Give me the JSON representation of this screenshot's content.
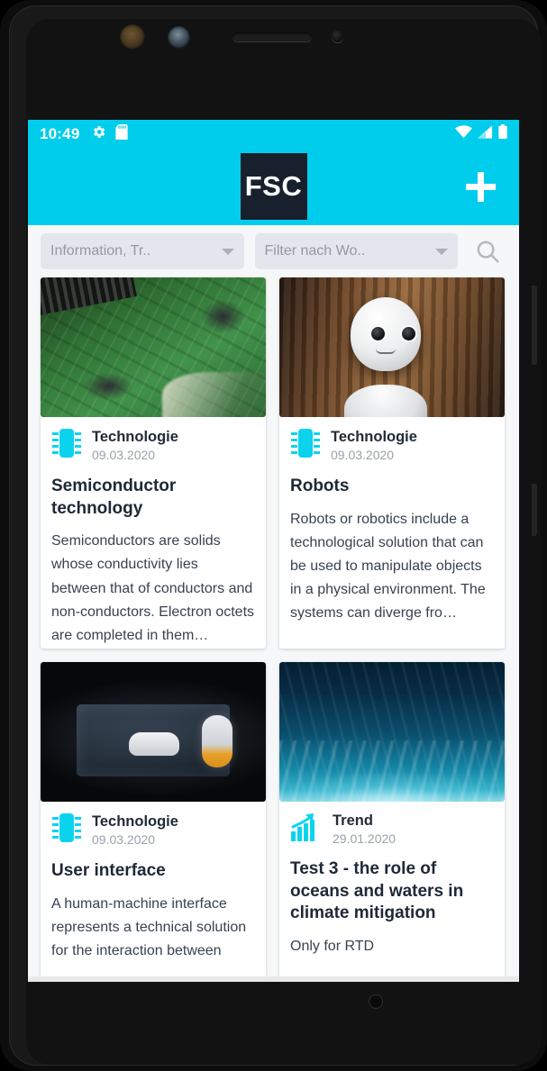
{
  "status_bar": {
    "time": "10:49",
    "left_icons": [
      "gear-icon",
      "sd-card-icon"
    ],
    "right_icons": [
      "wifi-icon",
      "signal-icon",
      "battery-icon"
    ]
  },
  "app_bar": {
    "logo_text": "FSC",
    "logo_bg": "#18202e",
    "background": "#00cdec",
    "add_label": "+"
  },
  "filters": {
    "category_filter": {
      "value": "Information, Tr..",
      "icon": "chevron-down-icon"
    },
    "word_filter": {
      "value": "Filter nach Wo..",
      "icon": "chevron-down-icon"
    },
    "search": {
      "icon": "search-icon"
    }
  },
  "cards": [
    {
      "image": "circuit-board-photo",
      "icon": "microchip-icon",
      "category": "Technologie",
      "date": "09.03.2020",
      "title": "Semiconductor technology",
      "body": "Semiconductors are solids whose conductivity lies between that of conductors and non-conductors. Electron octets are completed in them…"
    },
    {
      "image": "robot-photo",
      "icon": "microchip-icon",
      "category": "Technologie",
      "date": "09.03.2020",
      "title": "Robots",
      "body": "Robots or robotics include a technological solution that can be used to manipulate objects in a physical environment. The systems can diverge fro…"
    },
    {
      "image": "car-dashboard-photo",
      "icon": "microchip-icon",
      "category": "Technologie",
      "date": "09.03.2020",
      "title": "User interface",
      "body": "A human-machine interface represents a technical solution for the interaction between"
    },
    {
      "image": "ocean-underwater-photo",
      "icon": "trend-chart-icon",
      "category": "Trend",
      "date": "29.01.2020",
      "title": "Test 3 - the role of oceans and waters in climate mitigation",
      "body": "Only for RTD"
    }
  ],
  "theme": {
    "accent": "#00cdec",
    "page_bg": "#f6f7f8",
    "card_bg": "#ffffff",
    "title_color": "#1e2836",
    "muted_color": "#9aa1a8"
  }
}
